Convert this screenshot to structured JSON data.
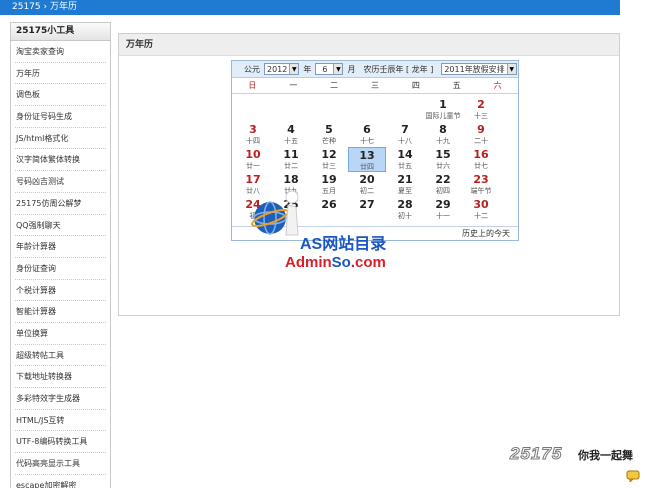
{
  "topbar": {
    "breadcrumb": "25175 › 万年历"
  },
  "sidebar": {
    "title": "25175小工具",
    "items": [
      "淘宝卖家查询",
      "万年历",
      "调色板",
      "身份证号码生成",
      "JS/html格式化",
      "汉字简体繁体转换",
      "号码凶吉测试",
      "25175仿周公解梦",
      "QQ强制聊天",
      "年龄计算器",
      "身份证查询",
      "个税计算器",
      "智能计算器",
      "单位换算",
      "超级转帖工具",
      "下载地址转换器",
      "多彩特效字生成器",
      "HTML/JS互转",
      "UTF-8编码转换工具",
      "代码高亮显示工具",
      "escape加密解密"
    ]
  },
  "main": {
    "title": "万年历"
  },
  "calendar": {
    "era_label": "公元",
    "year": "2012",
    "month": "6",
    "month_unit": "月",
    "lunar_info": "农历壬辰年 [ 龙年 ]",
    "holiday_select": "2011年放假安排",
    "weekdays": [
      "日",
      "一",
      "二",
      "三",
      "四",
      "五",
      "六"
    ],
    "days": [
      {
        "d": "1",
        "l": "国际儿童节",
        "col": 5,
        "row": 0
      },
      {
        "d": "2",
        "l": "十三",
        "col": 6,
        "row": 0
      },
      {
        "d": "3",
        "l": "十四",
        "col": 0,
        "row": 1
      },
      {
        "d": "4",
        "l": "十五",
        "col": 1,
        "row": 1
      },
      {
        "d": "5",
        "l": "芒种",
        "col": 2,
        "row": 1
      },
      {
        "d": "6",
        "l": "十七",
        "col": 3,
        "row": 1
      },
      {
        "d": "7",
        "l": "十八",
        "col": 4,
        "row": 1
      },
      {
        "d": "8",
        "l": "十九",
        "col": 5,
        "row": 1
      },
      {
        "d": "9",
        "l": "二十",
        "col": 6,
        "row": 1
      },
      {
        "d": "10",
        "l": "廿一",
        "col": 0,
        "row": 2
      },
      {
        "d": "11",
        "l": "廿二",
        "col": 1,
        "row": 2
      },
      {
        "d": "12",
        "l": "廿三",
        "col": 2,
        "row": 2
      },
      {
        "d": "13",
        "l": "廿四",
        "col": 3,
        "row": 2,
        "today": true
      },
      {
        "d": "14",
        "l": "廿五",
        "col": 4,
        "row": 2
      },
      {
        "d": "15",
        "l": "廿六",
        "col": 5,
        "row": 2
      },
      {
        "d": "16",
        "l": "廿七",
        "col": 6,
        "row": 2
      },
      {
        "d": "17",
        "l": "廿八",
        "col": 0,
        "row": 3
      },
      {
        "d": "18",
        "l": "廿九",
        "col": 1,
        "row": 3
      },
      {
        "d": "19",
        "l": "五月",
        "col": 2,
        "row": 3
      },
      {
        "d": "20",
        "l": "初二",
        "col": 3,
        "row": 3
      },
      {
        "d": "21",
        "l": "夏至",
        "col": 4,
        "row": 3
      },
      {
        "d": "22",
        "l": "初四",
        "col": 5,
        "row": 3
      },
      {
        "d": "23",
        "l": "端午节",
        "col": 6,
        "row": 3
      },
      {
        "d": "24",
        "l": "初",
        "col": 0,
        "row": 4
      },
      {
        "d": "25",
        "l": "",
        "col": 1,
        "row": 4
      },
      {
        "d": "26",
        "l": "",
        "col": 2,
        "row": 4
      },
      {
        "d": "27",
        "l": "",
        "col": 3,
        "row": 4
      },
      {
        "d": "28",
        "l": "初十",
        "col": 4,
        "row": 4
      },
      {
        "d": "29",
        "l": "十一",
        "col": 5,
        "row": 4
      },
      {
        "d": "30",
        "l": "十二",
        "col": 6,
        "row": 4
      }
    ],
    "footer_link": "历史上的今天"
  },
  "watermark": {
    "line1": "AS网站目录",
    "line2_red": "Admin",
    "line2_blue": "So",
    "line2_end": ".com"
  },
  "corner": {
    "number": "25175",
    "slogan": "你我一起舞"
  },
  "colors": {
    "topbar": "#1f7bd1",
    "today": "#b9d6f7",
    "weekend": "#b82020"
  }
}
